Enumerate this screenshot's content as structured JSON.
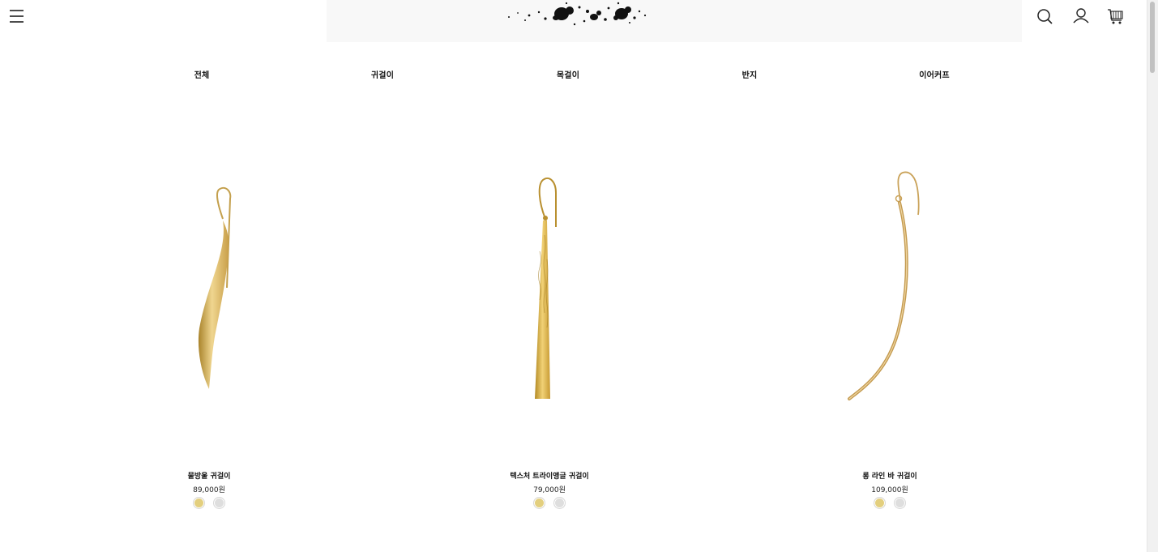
{
  "header": {
    "menu_icon": "hamburger-menu-icon",
    "search_icon": "search-icon",
    "account_icon": "user-icon",
    "cart_icon": "shopping-cart-icon"
  },
  "categories": [
    "전체",
    "귀걸이",
    "목걸이",
    "반지",
    "이어커프"
  ],
  "products": [
    {
      "name": "물방울 귀걸이",
      "price": "89,000원",
      "swatches": [
        "#e3cf7e",
        "#dedede"
      ]
    },
    {
      "name": "텍스처 트라이앵글 귀걸이",
      "price": "79,000원",
      "swatches": [
        "#e3cf7e",
        "#dedede"
      ]
    },
    {
      "name": "롱 라인 바 귀걸이",
      "price": "109,000원",
      "swatches": [
        "#e3cf7e",
        "#dedede"
      ]
    }
  ],
  "colors": {
    "gold": "#e3cf7e",
    "silver": "#dedede",
    "jewelry_gold": "#d9b24a"
  }
}
